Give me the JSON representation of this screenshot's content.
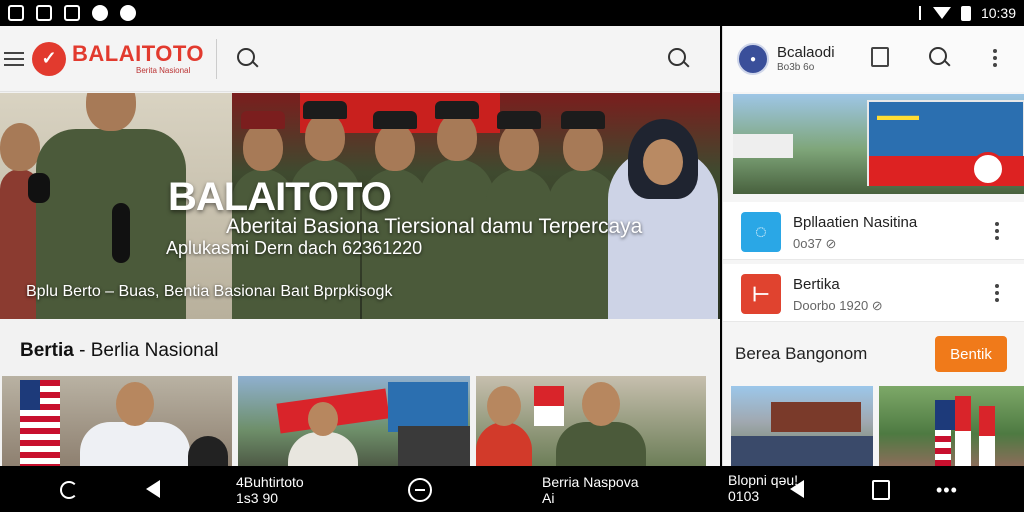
{
  "status_bar": {
    "time": "10:39",
    "left_icons": [
      "image-icon",
      "image-icon",
      "chart-icon",
      "location-icon",
      "vpn-icon"
    ],
    "right_icons": [
      "menu-icon",
      "wifi-icon",
      "battery-icon"
    ]
  },
  "left_app": {
    "brand": {
      "name": "BALAITOTO",
      "tagline": "Berita Nasional"
    },
    "hero": {
      "title": "BALAITOTO",
      "subtitle1": "Aberitai Basiona Tiersional damu Terpercaya",
      "subtitle2": "Aplukasmi Dern dach 62361220",
      "caption": "Bplu Berto – Buas, Bentia Basionaı Baıt Bprpkisogk"
    },
    "section": {
      "bold": "Bertia",
      "rest": " - Berlia Nasional"
    }
  },
  "right_app": {
    "profile": {
      "name": "Bcalaodi",
      "handle": "Bo3b 6o"
    },
    "items": [
      {
        "title": "Bpllaatien Nasitina",
        "meta": "0o37 ⊘"
      },
      {
        "title": "Bertika",
        "meta": "Doorbo 1920 ⊘"
      }
    ],
    "section_title": "Berea Bangonom",
    "button_label": "Bentik"
  },
  "nav_bar": {
    "left_label_line1": "4Buhtirtoto",
    "left_label_line2": "1s3 90",
    "center_label_line1": "Berria Naspova",
    "center_label_line2": "Ai",
    "right_label_line1": "Blopni qəu!",
    "right_label_line2": "0103"
  },
  "colors": {
    "brand_red": "#e23a2e",
    "accent_orange": "#f07a1a",
    "item_blue": "#2aa7e6",
    "item_red": "#e0432f"
  }
}
